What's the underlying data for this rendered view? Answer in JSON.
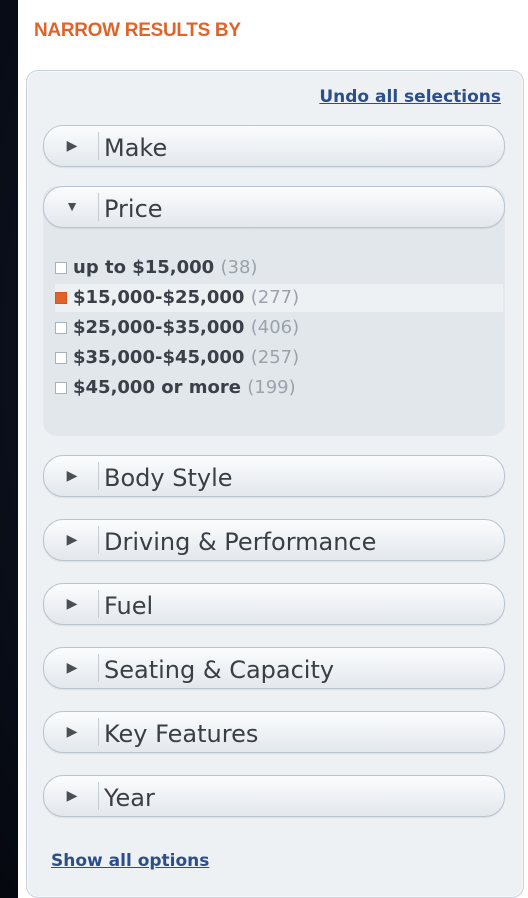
{
  "header": {
    "title": "NARROW RESULTS BY"
  },
  "panel": {
    "undo_label": "Undo all selections",
    "show_all_label": "Show all options"
  },
  "sections": {
    "make": "Make",
    "price": "Price",
    "body_style": "Body Style",
    "driving": "Driving & Performance",
    "fuel": "Fuel",
    "seating": "Seating & Capacity",
    "key_features": "Key Features",
    "year": "Year"
  },
  "price_options": [
    {
      "label": "up to $15,000",
      "count": "(38)",
      "checked": false
    },
    {
      "label": "$15,000-$25,000",
      "count": "(277)",
      "checked": true
    },
    {
      "label": "$25,000-$35,000",
      "count": "(406)",
      "checked": false
    },
    {
      "label": "$35,000-$45,000",
      "count": "(257)",
      "checked": false
    },
    {
      "label": "$45,000 or more",
      "count": "(199)",
      "checked": false
    }
  ],
  "colors": {
    "accent": "#e0642a",
    "link": "#2c4f8a"
  },
  "icons": {
    "collapsed": "triangle-right-icon",
    "expanded": "triangle-down-icon"
  }
}
